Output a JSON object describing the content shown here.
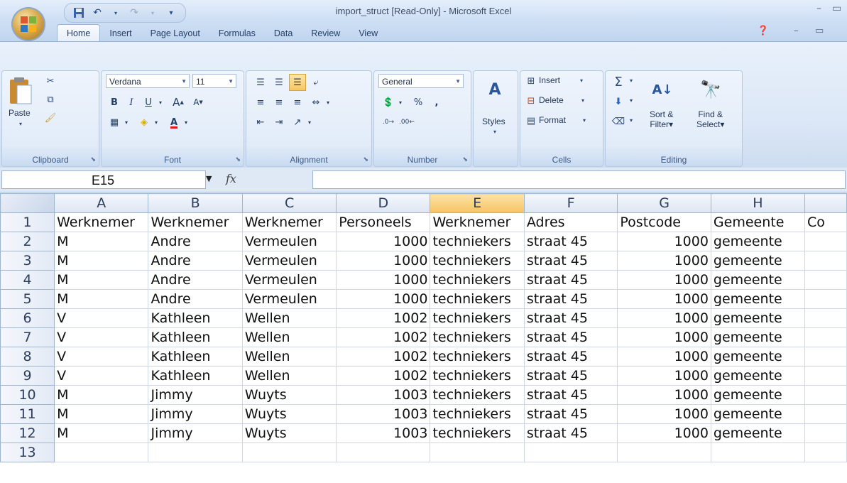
{
  "window": {
    "title": "import_struct  [Read-Only]  - Microsoft Excel",
    "controls": {
      "minimize": "–",
      "maximize": "▭"
    },
    "doc_controls": {
      "minimize": "–",
      "restore": "▭"
    }
  },
  "tabs": [
    "Home",
    "Insert",
    "Page Layout",
    "Formulas",
    "Data",
    "Review",
    "View"
  ],
  "ribbon": {
    "clipboard": {
      "label": "Clipboard",
      "paste": "Paste"
    },
    "font": {
      "label": "Font",
      "name": "Verdana",
      "size": "11"
    },
    "alignment": {
      "label": "Alignment"
    },
    "number": {
      "label": "Number",
      "format": "General"
    },
    "styles": {
      "label": "Styles"
    },
    "cells": {
      "label": "Cells",
      "insert": "Insert",
      "delete": "Delete",
      "format": "Format"
    },
    "editing": {
      "label": "Editing",
      "sort_line1": "Sort &",
      "sort_line2": "Filter",
      "find_line1": "Find &",
      "find_line2": "Select"
    }
  },
  "formula_bar": {
    "name_box": "E15",
    "fx": "fx",
    "content": ""
  },
  "sheet": {
    "columns": [
      "A",
      "B",
      "C",
      "D",
      "E",
      "F",
      "G",
      "H",
      ""
    ],
    "selected_column": "E",
    "rows": [
      {
        "n": "1",
        "cells": [
          "Werknemer",
          "Werknemer",
          "Werknemer",
          "Personeels",
          "Werknemer",
          "Adres",
          "Postcode",
          "Gemeente",
          "Co"
        ]
      },
      {
        "n": "2",
        "cells": [
          "M",
          "Andre",
          "Vermeulen",
          "1000",
          "techniekers",
          "straat 45",
          "1000",
          "gemeente",
          ""
        ]
      },
      {
        "n": "3",
        "cells": [
          "M",
          "Andre",
          "Vermeulen",
          "1000",
          "techniekers",
          "straat 45",
          "1000",
          "gemeente",
          ""
        ]
      },
      {
        "n": "4",
        "cells": [
          "M",
          "Andre",
          "Vermeulen",
          "1000",
          "techniekers",
          "straat 45",
          "1000",
          "gemeente",
          ""
        ]
      },
      {
        "n": "5",
        "cells": [
          "M",
          "Andre",
          "Vermeulen",
          "1000",
          "techniekers",
          "straat 45",
          "1000",
          "gemeente",
          ""
        ]
      },
      {
        "n": "6",
        "cells": [
          "V",
          "Kathleen",
          "Wellen",
          "1002",
          "techniekers",
          "straat 45",
          "1000",
          "gemeente",
          ""
        ]
      },
      {
        "n": "7",
        "cells": [
          "V",
          "Kathleen",
          "Wellen",
          "1002",
          "techniekers",
          "straat 45",
          "1000",
          "gemeente",
          ""
        ]
      },
      {
        "n": "8",
        "cells": [
          "V",
          "Kathleen",
          "Wellen",
          "1002",
          "techniekers",
          "straat 45",
          "1000",
          "gemeente",
          ""
        ]
      },
      {
        "n": "9",
        "cells": [
          "V",
          "Kathleen",
          "Wellen",
          "1002",
          "techniekers",
          "straat 45",
          "1000",
          "gemeente",
          ""
        ]
      },
      {
        "n": "10",
        "cells": [
          "M",
          "Jimmy",
          "Wuyts",
          "1003",
          "techniekers",
          "straat 45",
          "1000",
          "gemeente",
          ""
        ]
      },
      {
        "n": "11",
        "cells": [
          "M",
          "Jimmy",
          "Wuyts",
          "1003",
          "techniekers",
          "straat 45",
          "1000",
          "gemeente",
          ""
        ]
      },
      {
        "n": "12",
        "cells": [
          "M",
          "Jimmy",
          "Wuyts",
          "1003",
          "techniekers",
          "straat 45",
          "1000",
          "gemeente",
          ""
        ]
      },
      {
        "n": "13",
        "cells": [
          "",
          "",
          "",
          "",
          "",
          "",
          "",
          "",
          ""
        ]
      }
    ]
  }
}
